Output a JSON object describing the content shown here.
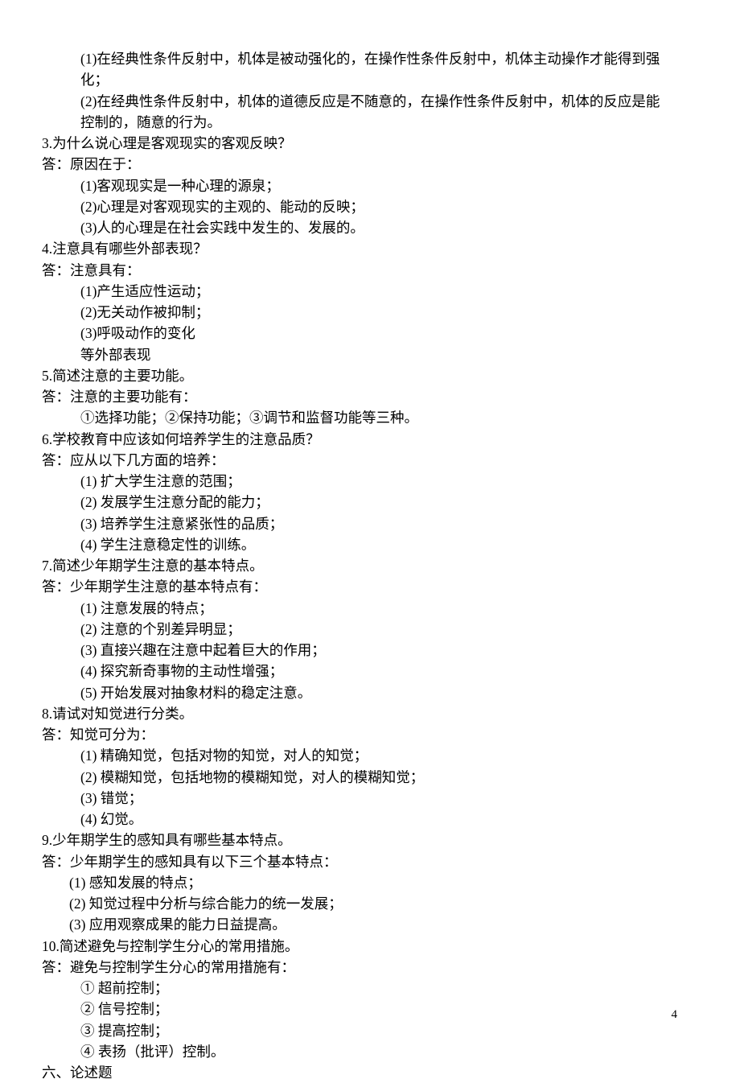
{
  "lines": [
    {
      "cls": "indent1",
      "text": "(1)在经典性条件反射中，机体是被动强化的，在操作性条件反射中，机体主动操作才能得到强"
    },
    {
      "cls": "indent1",
      "text": "化；"
    },
    {
      "cls": "indent1",
      "text": "(2)在经典性条件反射中，机体的道德反应是不随意的，在操作性条件反射中，机体的反应是能"
    },
    {
      "cls": "indent1",
      "text": "控制的，随意的行为。"
    },
    {
      "cls": "q",
      "text": "3.为什么说心理是客观现实的客观反映？"
    },
    {
      "cls": "ans",
      "text": "答：原因在于："
    },
    {
      "cls": "indent1",
      "text": "(1)客观现实是一种心理的源泉；"
    },
    {
      "cls": "indent1",
      "text": "(2)心理是对客观现实的主观的、能动的反映；"
    },
    {
      "cls": "indent1",
      "text": "(3)人的心理是在社会实践中发生的、发展的。"
    },
    {
      "cls": "q",
      "text": "4.注意具有哪些外部表现？"
    },
    {
      "cls": "ans",
      "text": "答：注意具有："
    },
    {
      "cls": "indent1",
      "text": "(1)产生适应性运动；"
    },
    {
      "cls": "indent1",
      "text": "(2)无关动作被抑制；"
    },
    {
      "cls": "indent1",
      "text": "(3)呼吸动作的变化"
    },
    {
      "cls": "indent1",
      "text": "等外部表现"
    },
    {
      "cls": "q",
      "text": "5.简述注意的主要功能。"
    },
    {
      "cls": "ans",
      "text": "答：注意的主要功能有："
    },
    {
      "cls": "indent1",
      "text": "①选择功能；②保持功能；③调节和监督功能等三种。"
    },
    {
      "cls": "q",
      "text": "6.学校教育中应该如何培养学生的注意品质？"
    },
    {
      "cls": "ans",
      "text": "答：应从以下几方面的培养："
    },
    {
      "cls": "indent1",
      "text": "(1) 扩大学生注意的范围；"
    },
    {
      "cls": "indent1",
      "text": "(2) 发展学生注意分配的能力；"
    },
    {
      "cls": "indent1",
      "text": "(3) 培养学生注意紧张性的品质；"
    },
    {
      "cls": "indent1",
      "text": "(4) 学生注意稳定性的训练。"
    },
    {
      "cls": "q",
      "text": "7.简述少年期学生注意的基本特点。"
    },
    {
      "cls": "ans",
      "text": "答：少年期学生注意的基本特点有："
    },
    {
      "cls": "indent1",
      "text": "(1) 注意发展的特点；"
    },
    {
      "cls": "indent1",
      "text": "(2) 注意的个别差异明显；"
    },
    {
      "cls": "indent1",
      "text": "(3) 直接兴趣在注意中起着巨大的作用；"
    },
    {
      "cls": "indent1",
      "text": "(4) 探究新奇事物的主动性增强；"
    },
    {
      "cls": "indent1",
      "text": "(5) 开始发展对抽象材料的稳定注意。"
    },
    {
      "cls": "q",
      "text": "8.请试对知觉进行分类。"
    },
    {
      "cls": "ans",
      "text": "答：知觉可分为："
    },
    {
      "cls": "indent1",
      "text": "(1) 精确知觉，包括对物的知觉，对人的知觉；"
    },
    {
      "cls": "indent1",
      "text": "(2) 模糊知觉，包括地物的模糊知觉，对人的模糊知觉；"
    },
    {
      "cls": "indent1",
      "text": "(3) 错觉；"
    },
    {
      "cls": "indent1",
      "text": "(4) 幻觉。"
    },
    {
      "cls": "q",
      "text": "9.少年期学生的感知具有哪些基本特点。"
    },
    {
      "cls": "ans",
      "text": "答：少年期学生的感知具有以下三个基本特点："
    },
    {
      "cls": "indent2",
      "text": "(1) 感知发展的特点；"
    },
    {
      "cls": "indent2",
      "text": "(2) 知觉过程中分析与综合能力的统一发展；"
    },
    {
      "cls": "indent2",
      "text": "(3) 应用观察成果的能力日益提高。"
    },
    {
      "cls": "q",
      "text": "10.简述避免与控制学生分心的常用措施。"
    },
    {
      "cls": "ans",
      "text": "答：避免与控制学生分心的常用措施有："
    },
    {
      "cls": "indent1",
      "text": "① 超前控制；"
    },
    {
      "cls": "indent1",
      "text": "② 信号控制；"
    },
    {
      "cls": "indent1",
      "text": "③ 提高控制；"
    },
    {
      "cls": "indent1",
      "text": "④ 表扬（批评）控制。"
    },
    {
      "cls": "q",
      "text": "六、论述题"
    }
  ],
  "page_number": "4"
}
